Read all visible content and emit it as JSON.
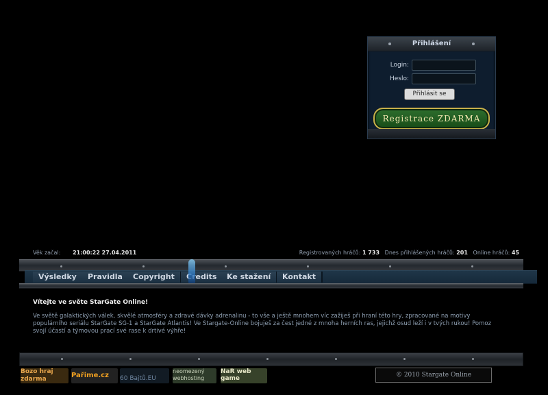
{
  "login": {
    "title": "Přihlášení",
    "login_label": "Login:",
    "password_label": "Heslo:",
    "login_button": "Přihlásit se",
    "register_button": "Registrace ZDARMA"
  },
  "stats": {
    "age_label": "Věk začal:",
    "age_value": "21:00:22 27.04.2011",
    "registered_label": "Registrovaných hráčů:",
    "registered_value": "1 733",
    "today_label": "Dnes přihlášených hráčů:",
    "today_value": "201",
    "online_label": "Online hráčů:",
    "online_value": "45"
  },
  "nav": {
    "items": [
      "Výsledky",
      "Pravidla",
      "Copyright",
      "Credits",
      "Ke stažení",
      "Kontakt"
    ]
  },
  "content": {
    "title": "Vítejte ve světe StarGate Online!",
    "text": "Ve světě galaktických válek, skvělé atmosféry a zdravé dávky adrenalinu - to vše a ještě mnohem víc zažiješ při hraní této hry, zpracované na motivy populárního seriálu StarGate SG-1 a StarGate Atlantis! Ve Stargate-Online bojuješ za čest jedné z mnoha herních ras, jejichž osud leží i v tvých rukou! Pomoz svojí účastí a týmovou prací své rase k drtivé výhře!"
  },
  "footer": {
    "banners": [
      "Bozo hraj zdarma",
      "Pařime.cz",
      "60 Bajtů.EU",
      "neomezený webhosting",
      "NaR web game"
    ],
    "copyright": "© 2010 Stargate Online"
  },
  "colors": {
    "background": "#000000",
    "panel": "#0e1d2e",
    "nav": "#1c3142",
    "register_gold": "#c8b04a",
    "register_green": "#2e6f2e"
  }
}
